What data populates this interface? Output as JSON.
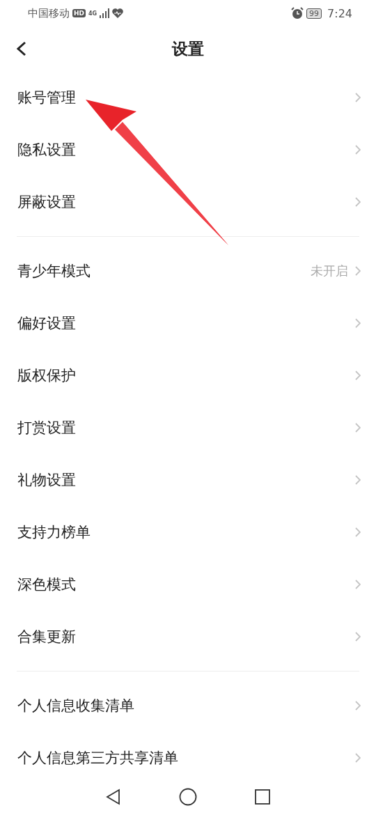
{
  "status_bar": {
    "carrier": "中国移动",
    "hd": "HD",
    "network": "4G",
    "battery": "99",
    "time": "7:24"
  },
  "header": {
    "title": "设置"
  },
  "groups": [
    {
      "items": [
        {
          "label": "账号管理"
        },
        {
          "label": "隐私设置"
        },
        {
          "label": "屏蔽设置"
        }
      ]
    },
    {
      "items": [
        {
          "label": "青少年模式",
          "value": "未开启"
        },
        {
          "label": "偏好设置"
        },
        {
          "label": "版权保护"
        },
        {
          "label": "打赏设置"
        },
        {
          "label": "礼物设置"
        },
        {
          "label": "支持力榜单"
        },
        {
          "label": "深色模式"
        },
        {
          "label": "合集更新"
        }
      ]
    },
    {
      "items": [
        {
          "label": "个人信息收集清单"
        },
        {
          "label": "个人信息第三方共享清单"
        }
      ]
    }
  ]
}
